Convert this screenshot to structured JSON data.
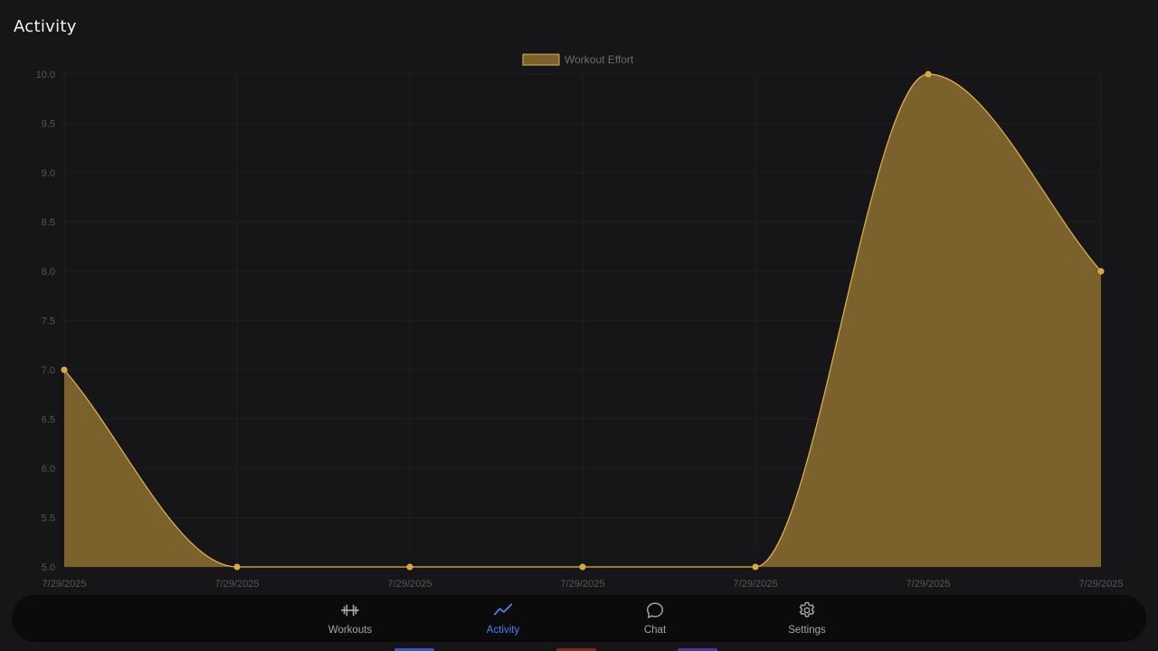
{
  "header": {
    "title": "Activity"
  },
  "chart_data": {
    "type": "area",
    "title": "",
    "xlabel": "",
    "ylabel": "",
    "x": [
      "7/29/2025",
      "7/29/2025",
      "7/29/2025",
      "7/29/2025",
      "7/29/2025",
      "7/29/2025",
      "7/29/2025"
    ],
    "series": [
      {
        "name": "Workout Effort",
        "values": [
          7.0,
          5.0,
          5.0,
          5.0,
          5.0,
          10.0,
          8.0
        ]
      }
    ],
    "ylim": [
      5.0,
      10.0
    ],
    "yticks": [
      "5.0",
      "5.5",
      "6.0",
      "6.5",
      "7.0",
      "7.5",
      "8.0",
      "8.5",
      "9.0",
      "9.5",
      "10.0"
    ],
    "grid": true,
    "legend_position": "top-center",
    "colors": {
      "line": "#e3b44a",
      "fill": "#7b622d",
      "point": "#e3b44a",
      "grid": "#1f1f22",
      "tick": "#56565c"
    }
  },
  "nav": {
    "items": [
      {
        "label": "Workouts",
        "icon": "dumbbell-icon",
        "active": false
      },
      {
        "label": "Activity",
        "icon": "trend-chart-icon",
        "active": true
      },
      {
        "label": "Chat",
        "icon": "chat-bubble-icon",
        "active": false
      },
      {
        "label": "Settings",
        "icon": "gear-icon",
        "active": false
      }
    ],
    "active_color": "#4f7df0",
    "inactive_color": "#a3a3a8"
  }
}
